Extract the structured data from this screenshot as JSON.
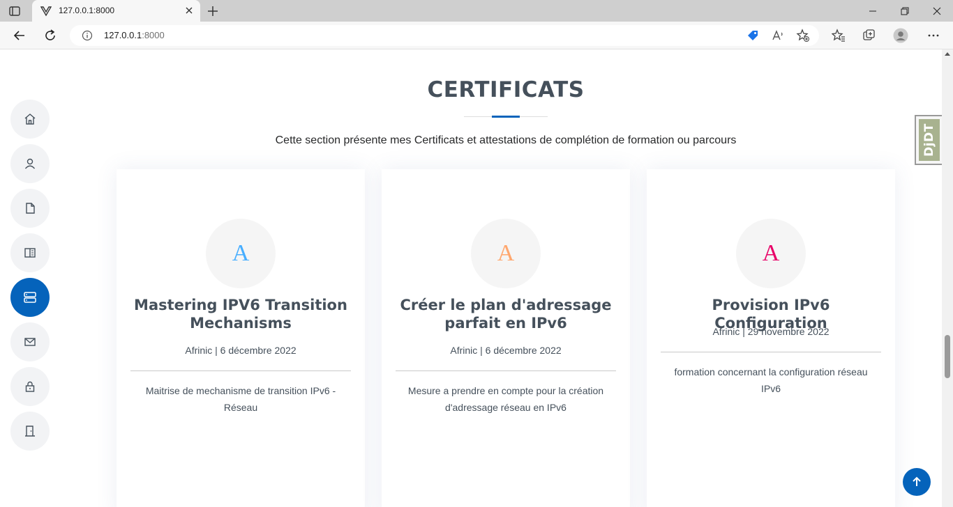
{
  "browser": {
    "tab_title": "127.0.0.1:8000",
    "url_host": "127.0.0.1",
    "url_port": ":8000"
  },
  "sidenav": {
    "items": [
      {
        "name": "home",
        "icon": "home-icon",
        "active": false
      },
      {
        "name": "about",
        "icon": "person-icon",
        "active": false
      },
      {
        "name": "resume",
        "icon": "file-icon",
        "active": false
      },
      {
        "name": "portfolio",
        "icon": "book-icon",
        "active": false
      },
      {
        "name": "certificats",
        "icon": "server-icon",
        "active": true
      },
      {
        "name": "contact",
        "icon": "envelope-icon",
        "active": false
      },
      {
        "name": "login",
        "icon": "lock-icon",
        "active": false
      },
      {
        "name": "logout",
        "icon": "door-icon",
        "active": false
      }
    ]
  },
  "section": {
    "title": "CERTIFICATS",
    "description": "Cette section présente mes Certificats et attestations de complétion de formation ou parcours"
  },
  "cards": [
    {
      "icon_letter": "A",
      "icon_color": "#47aeff",
      "title": "Mastering IPV6 Transition Mechanisms",
      "meta": "Afrinic | 6 décembre 2022",
      "text": "Maitrise de mechanisme de transition IPv6 - Réseau"
    },
    {
      "icon_letter": "A",
      "icon_color": "#ffa76e",
      "title": "Créer le plan d'adressage parfait en IPv6",
      "meta": "Afrinic | 6 décembre 2022",
      "text": "Mesure a prendre en compte pour la création d'adressage réseau en IPv6"
    },
    {
      "icon_letter": "A",
      "icon_color": "#e80368",
      "title": "Provision IPv6 Configuration",
      "meta": "Afrinic | 29 novembre 2022",
      "text": "formation concernant la configuration réseau IPv6"
    }
  ],
  "debug_toolbar": {
    "label": "DjDT"
  },
  "colors": {
    "accent": "#0563bb",
    "heading": "#45505b"
  }
}
